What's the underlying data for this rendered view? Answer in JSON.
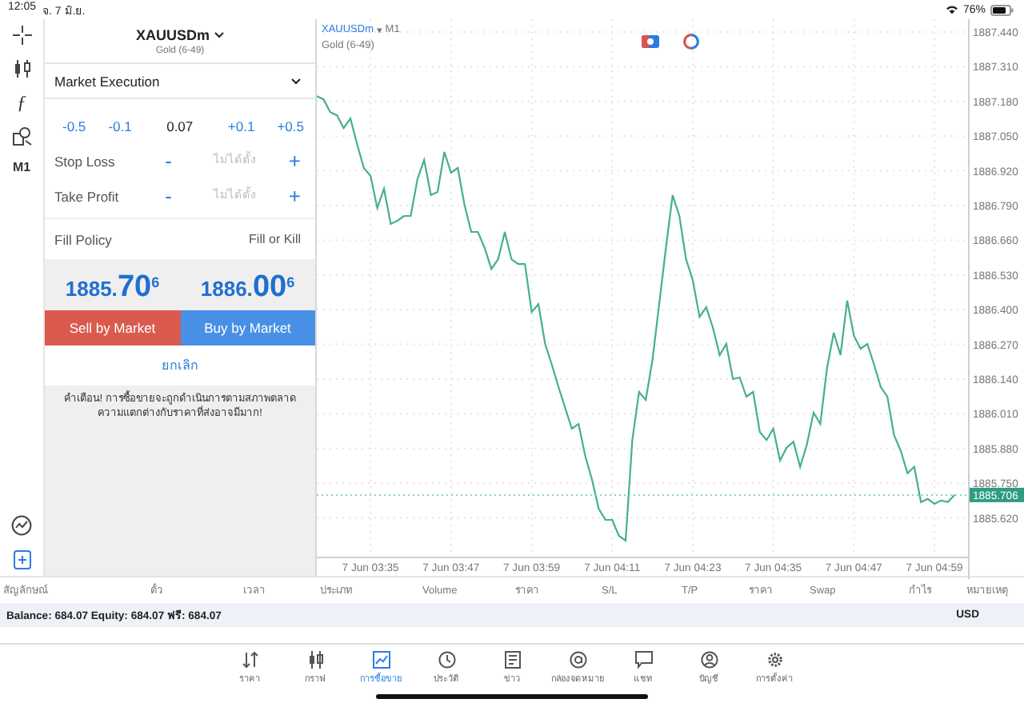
{
  "status_bar": {
    "time": "12:05",
    "date": "จ. 7 มิ.ย.",
    "battery": "76%"
  },
  "toolbar": {
    "function": "ƒ",
    "timeframe": "M1"
  },
  "order": {
    "symbol": "XAUUSDm",
    "description": "Gold (6-49)",
    "execution": "Market Execution",
    "volume_row": [
      {
        "kind": "step",
        "text": "-0.5"
      },
      {
        "kind": "step",
        "text": "-0.1"
      },
      {
        "kind": "value",
        "text": "0.07"
      },
      {
        "kind": "step",
        "text": "+0.1"
      },
      {
        "kind": "step",
        "text": "+0.5"
      }
    ],
    "stops": [
      {
        "label": "Stop Loss",
        "minus": "-",
        "placeholder": "ไม่ได้ตั้ง",
        "plus": "+"
      },
      {
        "label": "Take Profit",
        "minus": "-",
        "placeholder": "ไม่ได้ตั้ง",
        "plus": "+"
      }
    ],
    "fill_policy": {
      "label": "Fill Policy",
      "value": "Fill or Kill"
    },
    "bid": "1885.**70**$^{6}$",
    "ask": "1886.**00**$^{6}$",
    "sell_button": "Sell by Market",
    "buy_button": "Buy by Market",
    "cancel": "ยกเลิก",
    "warning": "คำเตือน! การซื้อขายจะถูกดำเนินการตามสภาพตลาด\nความแตกต่างกับราคาที่ส่งอาจมีมาก!"
  },
  "chart": {
    "symbol": "XAUUSDm",
    "marker": "▾",
    "timeframe": "M1",
    "description": "Gold (6-49)",
    "current_price": "1885.706",
    "chart_data": {
      "type": "line",
      "color": "#45b08c",
      "categories": [
        null,
        null,
        null,
        null,
        null,
        null,
        null,
        null,
        "7 Jun 03:35",
        null,
        null,
        null,
        null,
        null,
        null,
        null,
        null,
        null,
        null,
        null,
        "7 Jun 03:47",
        null,
        null,
        null,
        null,
        null,
        null,
        null,
        null,
        null,
        null,
        null,
        "7 Jun 03:59",
        null,
        null,
        null,
        null,
        null,
        null,
        null,
        null,
        null,
        null,
        null,
        "7 Jun 04:11",
        null,
        null,
        null,
        null,
        null,
        null,
        null,
        null,
        null,
        null,
        null,
        "7 Jun 04:23",
        null,
        null,
        null,
        null,
        null,
        null,
        null,
        null,
        null,
        null,
        null,
        "7 Jun 04:35",
        null,
        null,
        null,
        null,
        null,
        null,
        null,
        null,
        null,
        null,
        null,
        "7 Jun 04:47",
        null,
        null,
        null,
        null,
        null,
        null,
        null,
        null,
        null,
        null,
        null,
        "7 Jun 04:59",
        null,
        null,
        null
      ],
      "values": [
        1887.2,
        1887.188,
        1887.14,
        1887.128,
        1887.08,
        1887.116,
        1887.02,
        1886.931,
        1886.901,
        1886.781,
        1886.853,
        1886.721,
        1886.733,
        1886.751,
        1886.751,
        1886.889,
        1886.961,
        1886.829,
        1886.841,
        1886.991,
        1886.913,
        1886.931,
        1886.793,
        1886.691,
        1886.691,
        1886.631,
        1886.553,
        1886.589,
        1886.691,
        1886.589,
        1886.571,
        1886.571,
        1886.391,
        1886.421,
        1886.272,
        1886.194,
        1886.11,
        1886.032,
        1885.954,
        1885.972,
        1885.852,
        1885.763,
        1885.655,
        1885.613,
        1885.613,
        1885.553,
        1885.535,
        1885.912,
        1886.092,
        1886.062,
        1886.212,
        1886.421,
        1886.631,
        1886.829,
        1886.751,
        1886.589,
        1886.511,
        1886.373,
        1886.409,
        1886.332,
        1886.23,
        1886.272,
        1886.14,
        1886.146,
        1886.074,
        1886.092,
        1885.942,
        1885.912,
        1885.954,
        1885.835,
        1885.883,
        1885.906,
        1885.811,
        1885.895,
        1886.014,
        1885.972,
        1886.182,
        1886.314,
        1886.23,
        1886.434,
        1886.302,
        1886.254,
        1886.272,
        1886.194,
        1886.11,
        1886.074,
        1885.93,
        1885.871,
        1885.787,
        1885.811,
        1885.679,
        1885.691,
        1885.673,
        1885.685,
        1885.679,
        1885.706
      ],
      "ylim": [
        1885.475,
        1887.488
      ],
      "grid": true,
      "yticks": [
        {
          "value": 1887.44,
          "label": "1887.440"
        },
        {
          "value": 1887.31,
          "label": "1887.310"
        },
        {
          "value": 1887.18,
          "label": "1887.180"
        },
        {
          "value": 1887.05,
          "label": "1887.050"
        },
        {
          "value": 1886.92,
          "label": "1886.920"
        },
        {
          "value": 1886.79,
          "label": "1886.790"
        },
        {
          "value": 1886.66,
          "label": "1886.660"
        },
        {
          "value": 1886.53,
          "label": "1886.530"
        },
        {
          "value": 1886.4,
          "label": "1886.400"
        },
        {
          "value": 1886.27,
          "label": "1886.270"
        },
        {
          "value": 1886.14,
          "label": "1886.140"
        },
        {
          "value": 1886.01,
          "label": "1886.010"
        },
        {
          "value": 1885.88,
          "label": "1885.880"
        },
        {
          "value": 1885.75,
          "label": "1885.750"
        },
        {
          "value": 1885.62,
          "label": "1885.620"
        }
      ]
    }
  },
  "positions": {
    "columns": [
      "สัญลักษณ์",
      "ตั๋ว",
      "เวลา",
      "ประเภท",
      "Volume",
      "ราคา",
      "S/L",
      "T/P",
      "ราคา",
      "Swap",
      "กำไร",
      "หมายเหตุ"
    ]
  },
  "balance": {
    "summary": "Balance: 684.07 Equity: 684.07 ฟรี: 684.07",
    "currency": "USD"
  },
  "tabs": [
    {
      "label": "ราคา",
      "selected": false
    },
    {
      "label": "กราฟ",
      "selected": false
    },
    {
      "label": "การซื้อขาย",
      "selected": true
    },
    {
      "label": "ประวัติ",
      "selected": false
    },
    {
      "label": "ข่าว",
      "selected": false
    },
    {
      "label": "กล่องจดหมาย",
      "selected": false
    },
    {
      "label": "แชท",
      "selected": false
    },
    {
      "label": "บัญชี",
      "selected": false
    },
    {
      "label": "การตั้งค่า",
      "selected": false
    }
  ]
}
